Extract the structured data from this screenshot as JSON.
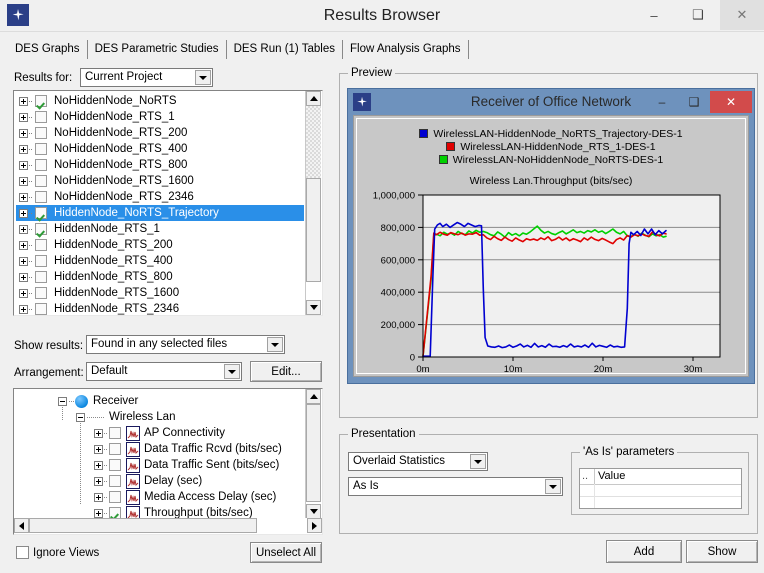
{
  "window": {
    "title": "Results Browser",
    "icon": "app-star-icon",
    "minimize": "–",
    "maximize": "❑",
    "close": "✕"
  },
  "tabs": [
    {
      "label": "DES Graphs",
      "active": true
    },
    {
      "label": "DES Parametric Studies",
      "active": false
    },
    {
      "label": "DES Run (1) Tables",
      "active": false
    },
    {
      "label": "Flow Analysis Graphs",
      "active": false
    }
  ],
  "results_for": {
    "label": "Results for:",
    "value": "Current Project"
  },
  "file_list": [
    {
      "label": "NoHiddenNode_NoRTS",
      "checked": true,
      "selected": false
    },
    {
      "label": "NoHiddenNode_RTS_1",
      "checked": false,
      "selected": false
    },
    {
      "label": "NoHiddenNode_RTS_200",
      "checked": false,
      "selected": false
    },
    {
      "label": "NoHiddenNode_RTS_400",
      "checked": false,
      "selected": false
    },
    {
      "label": "NoHiddenNode_RTS_800",
      "checked": false,
      "selected": false
    },
    {
      "label": "NoHiddenNode_RTS_1600",
      "checked": false,
      "selected": false
    },
    {
      "label": "NoHiddenNode_RTS_2346",
      "checked": false,
      "selected": false
    },
    {
      "label": "HiddenNode_NoRTS_Trajectory",
      "checked": true,
      "selected": true
    },
    {
      "label": "HiddenNode_RTS_1",
      "checked": true,
      "selected": false
    },
    {
      "label": "HiddenNode_RTS_200",
      "checked": false,
      "selected": false
    },
    {
      "label": "HiddenNode_RTS_400",
      "checked": false,
      "selected": false
    },
    {
      "label": "HiddenNode_RTS_800",
      "checked": false,
      "selected": false
    },
    {
      "label": "HiddenNode_RTS_1600",
      "checked": false,
      "selected": false
    },
    {
      "label": "HiddenNode_RTS_2346",
      "checked": false,
      "selected": false
    }
  ],
  "show_results": {
    "label": "Show results:",
    "value": "Found in any selected files"
  },
  "arrangement": {
    "label": "Arrangement:",
    "value": "Default",
    "edit_button": "Edit..."
  },
  "stat_tree": [
    {
      "label": "Receiver",
      "depth": 0,
      "kind": "node",
      "expander": "minus",
      "checked": null
    },
    {
      "label": "Wireless Lan",
      "depth": 1,
      "kind": "group",
      "expander": "minus",
      "checked": null
    },
    {
      "label": "AP Connectivity",
      "depth": 2,
      "kind": "stat",
      "expander": "plus",
      "checked": false
    },
    {
      "label": "Data Traffic Rcvd (bits/sec)",
      "depth": 2,
      "kind": "stat",
      "expander": "plus",
      "checked": false
    },
    {
      "label": "Data Traffic Sent (bits/sec)",
      "depth": 2,
      "kind": "stat",
      "expander": "plus",
      "checked": false
    },
    {
      "label": "Delay (sec)",
      "depth": 2,
      "kind": "stat",
      "expander": "plus",
      "checked": false
    },
    {
      "label": "Media Access Delay (sec)",
      "depth": 2,
      "kind": "stat",
      "expander": "plus",
      "checked": false
    },
    {
      "label": "Throughput (bits/sec)",
      "depth": 2,
      "kind": "stat",
      "expander": "plus",
      "checked": true
    }
  ],
  "ignore_views": {
    "label": "Ignore Views",
    "checked": false
  },
  "unselect_all": "Unselect All",
  "preview": {
    "group_title": "Preview",
    "inner_window_title": "Receiver of Office Network",
    "icon": "app-star-icon",
    "minimize": "–",
    "maximize": "❑",
    "close": "✕"
  },
  "presentation": {
    "group_title": "Presentation",
    "mode": "Overlaid Statistics",
    "draw_style": "As Is",
    "params_group_title": "'As Is' parameters",
    "params_columns": [
      "..",
      "Value"
    ],
    "params_rows": [
      [
        "",
        ""
      ],
      [
        "",
        ""
      ]
    ],
    "add_button": "Add",
    "show_button": "Show"
  },
  "chart_data": {
    "type": "line",
    "title": "Wireless Lan.Throughput (bits/sec)",
    "xlabel": "",
    "ylabel": "",
    "xlim": [
      0,
      33
    ],
    "ylim": [
      0,
      1000000
    ],
    "xticks": [
      "0m",
      "10m",
      "20m",
      "30m"
    ],
    "xtick_values": [
      0,
      10,
      20,
      30
    ],
    "yticks": [
      "0",
      "200,000",
      "400,000",
      "600,000",
      "800,000",
      "1,000,000"
    ],
    "ytick_values": [
      0,
      200000,
      400000,
      600000,
      800000,
      1000000
    ],
    "grid": true,
    "legend_position": "top-center",
    "colors": {
      "blue": "#0000d0",
      "red": "#e00000",
      "green": "#00d000"
    },
    "series": [
      {
        "name": "WirelessLAN-HiddenNode_NoRTS_Trajectory-DES-1",
        "color": "#0000d0",
        "x": [
          0.0,
          0.8,
          1.1,
          1.3,
          1.6,
          1.9,
          2.2,
          2.6,
          3.0,
          3.4,
          3.8,
          4.2,
          4.6,
          5.0,
          5.4,
          5.8,
          6.2,
          6.5,
          6.7,
          6.9,
          7.2,
          7.6,
          8.0,
          8.4,
          8.8,
          9.2,
          9.6,
          10.0,
          10.4,
          10.8,
          11.2,
          11.6,
          12.0,
          12.4,
          12.8,
          13.2,
          13.6,
          14.0,
          14.4,
          14.8,
          15.2,
          15.6,
          16.0,
          16.4,
          16.8,
          17.2,
          17.6,
          18.0,
          18.4,
          18.8,
          19.2,
          19.6,
          20.0,
          20.4,
          20.8,
          21.2,
          21.6,
          22.0,
          22.4,
          22.7,
          22.9,
          23.1,
          23.4,
          23.8,
          24.2,
          24.6,
          25.0,
          25.4,
          25.8,
          26.2,
          26.6,
          27.0
        ],
        "y": [
          5000,
          5000,
          500000,
          790000,
          815000,
          825000,
          805000,
          820000,
          800000,
          815000,
          830000,
          820000,
          805000,
          825000,
          815000,
          805000,
          812000,
          810000,
          420000,
          120000,
          68000,
          62000,
          60000,
          68000,
          58000,
          62000,
          74000,
          60000,
          68000,
          80000,
          62000,
          72000,
          60000,
          84000,
          62000,
          70000,
          60000,
          80000,
          64000,
          66000,
          60000,
          70000,
          62000,
          80000,
          62000,
          68000,
          62000,
          74000,
          60000,
          85000,
          62000,
          72000,
          66000,
          60000,
          74000,
          62000,
          66000,
          60000,
          62000,
          300000,
          700000,
          770000,
          755000,
          775000,
          750000,
          790000,
          760000,
          790000,
          755000,
          780000,
          760000,
          780000
        ]
      },
      {
        "name": "WirelessLAN-HiddenNode_RTS_1-DES-1",
        "color": "#e00000",
        "x": [
          0.0,
          0.9,
          1.2,
          1.5,
          1.9,
          2.3,
          2.7,
          3.1,
          3.5,
          3.9,
          4.3,
          4.7,
          5.1,
          5.5,
          5.9,
          6.3,
          6.7,
          7.1,
          7.5,
          7.9,
          8.3,
          8.7,
          9.1,
          9.5,
          9.9,
          10.3,
          10.7,
          11.1,
          11.5,
          11.9,
          12.3,
          12.7,
          13.1,
          13.5,
          13.9,
          14.3,
          14.7,
          15.1,
          15.5,
          15.9,
          16.3,
          16.7,
          17.1,
          17.5,
          17.9,
          18.3,
          18.7,
          19.1,
          19.5,
          19.9,
          20.3,
          20.7,
          21.1,
          21.5,
          21.9,
          22.3,
          22.7,
          23.1,
          23.5,
          23.9,
          24.3,
          24.7,
          25.1,
          25.5,
          25.9,
          26.3,
          26.7,
          27.0
        ],
        "y": [
          5000,
          500000,
          765000,
          755000,
          770000,
          758000,
          752000,
          768000,
          760000,
          755000,
          765000,
          752000,
          760000,
          758000,
          768000,
          752000,
          755000,
          735000,
          725000,
          745000,
          730000,
          720000,
          740000,
          725000,
          715000,
          735000,
          722000,
          712000,
          730000,
          722000,
          728000,
          720000,
          735000,
          725000,
          742000,
          718000,
          726000,
          740000,
          722000,
          735000,
          718000,
          730000,
          722000,
          712000,
          735000,
          722000,
          740000,
          726000,
          718000,
          732000,
          722000,
          710000,
          700000,
          725000,
          735000,
          722000,
          750000,
          740000,
          755000,
          748000,
          760000,
          750000,
          745000,
          772000,
          755000,
          748000,
          765000,
          760000
        ]
      },
      {
        "name": "WirelessLAN-NoHiddenNode_NoRTS-DES-1",
        "color": "#00d000",
        "x": [
          0.0,
          0.9,
          1.2,
          1.5,
          1.9,
          2.3,
          2.7,
          3.1,
          3.5,
          3.9,
          4.3,
          4.7,
          5.1,
          5.5,
          5.9,
          6.3,
          6.7,
          7.1,
          7.5,
          7.9,
          8.3,
          8.7,
          9.1,
          9.5,
          9.9,
          10.3,
          10.7,
          11.1,
          11.5,
          11.9,
          12.3,
          12.7,
          13.1,
          13.5,
          13.9,
          14.3,
          14.7,
          15.1,
          15.5,
          15.9,
          16.3,
          16.7,
          17.1,
          17.5,
          17.9,
          18.3,
          18.7,
          19.1,
          19.5,
          19.9,
          20.3,
          20.7,
          21.1,
          21.5,
          21.9,
          22.3,
          22.7,
          23.1,
          23.5,
          23.9,
          24.3,
          24.7,
          25.1,
          25.5,
          25.9,
          26.3,
          26.7,
          27.0
        ],
        "y": [
          5000,
          480000,
          750000,
          758000,
          748000,
          770000,
          758000,
          765000,
          752000,
          775000,
          762000,
          755000,
          778000,
          765000,
          782000,
          770000,
          775000,
          768000,
          755000,
          748000,
          772000,
          758000,
          740000,
          768000,
          752000,
          762000,
          748000,
          765000,
          758000,
          772000,
          790000,
          808000,
          782000,
          765000,
          775000,
          762000,
          755000,
          768000,
          778000,
          760000,
          772000,
          785000,
          768000,
          775000,
          765000,
          780000,
          772000,
          785000,
          770000,
          778000,
          762000,
          775000,
          790000,
          770000,
          760000,
          775000,
          748000,
          742000,
          758000,
          745000,
          765000,
          752000,
          742000,
          760000,
          748000,
          755000,
          740000,
          745000
        ]
      }
    ]
  }
}
